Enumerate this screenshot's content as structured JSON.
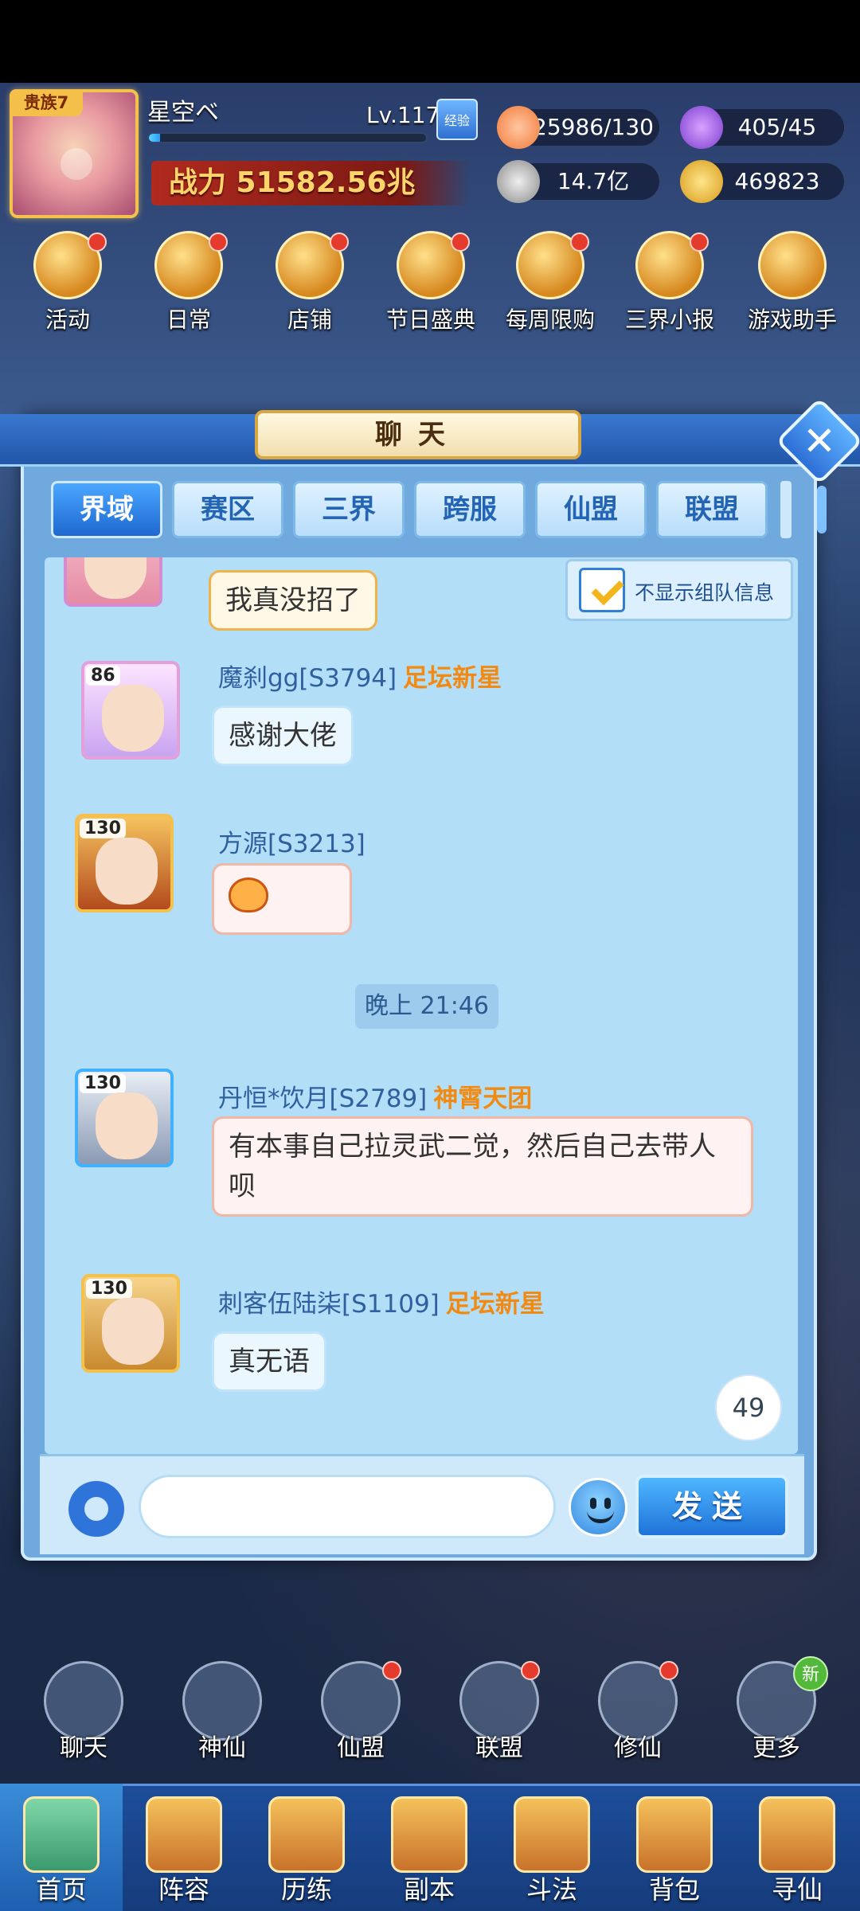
{
  "player": {
    "vip": "贵族7",
    "name": "星空ベ",
    "level": "Lv.117",
    "exp_label": "经验",
    "exp_progress": 0.04,
    "power": "战力 51582.56兆"
  },
  "resources": {
    "stamina": "25986/130",
    "energy": "405/45",
    "silver": "14.7亿",
    "gold": "469823"
  },
  "top_menu": [
    "活动",
    "日常",
    "店铺",
    "节日盛典",
    "每周限购",
    "三界小报",
    "游戏助手"
  ],
  "chat": {
    "title": "聊天",
    "tabs": [
      "界域",
      "赛区",
      "三界",
      "跨服",
      "仙盟",
      "联盟"
    ],
    "active_tab": "界域",
    "filter_label": "不显示组队信息",
    "messages": [
      {
        "sender": "",
        "title": "",
        "level": "",
        "text": "我真没招了"
      },
      {
        "sender": "魔刹gg[S3794]",
        "title": "足坛新星",
        "level": "86",
        "text": "感谢大佬"
      },
      {
        "sender": "方源[S3213]",
        "title": "",
        "level": "130",
        "text": ""
      },
      {
        "sender": "丹恒*饮月[S2789]",
        "title": "神霄天团",
        "level": "130",
        "text": "有本事自己拉灵武二觉，然后自己去带人呗"
      },
      {
        "sender": "刺客伍陆柒[S1109]",
        "title": "足坛新星",
        "level": "130",
        "text": "真无语"
      }
    ],
    "timestamp": "晚上 21:46",
    "unread_count": "49",
    "input_placeholder": "",
    "send_label": "发送"
  },
  "bottom_menu": [
    "聊天",
    "神仙",
    "仙盟",
    "联盟",
    "修仙",
    "更多"
  ],
  "new_badge": "新",
  "nav": [
    "首页",
    "阵容",
    "历练",
    "副本",
    "斗法",
    "背包",
    "寻仙"
  ],
  "active_nav": "首页",
  "colors": {
    "accent_blue": "#1f68d1",
    "title_orange": "#f28a12",
    "sender_blue": "#2f5f9e",
    "chat_bg": "#b3def8"
  }
}
